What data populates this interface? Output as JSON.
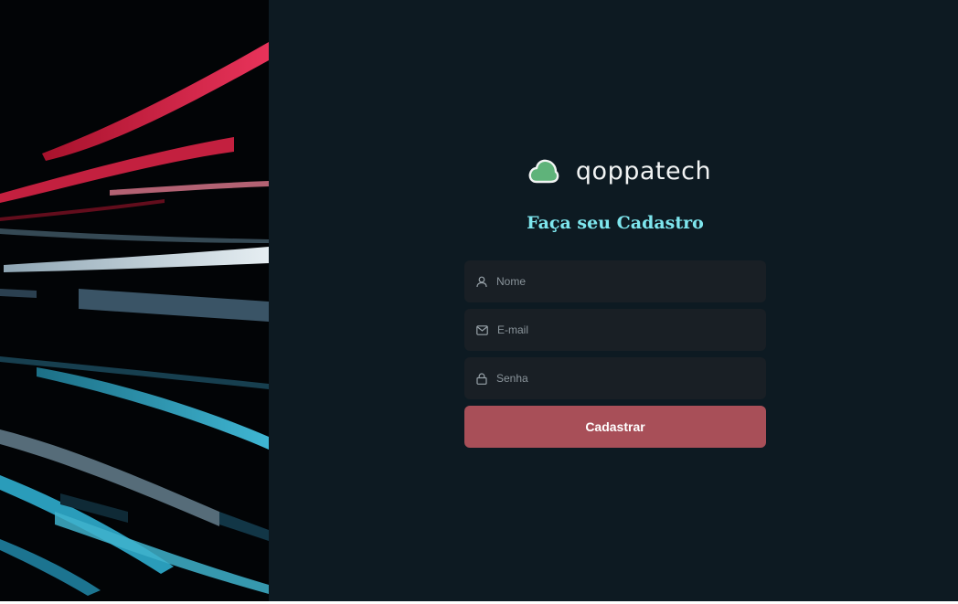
{
  "brand": {
    "name": "qoppatech",
    "logo_icon": "cloud-icon",
    "logo_color": "#5fb37a"
  },
  "form": {
    "title": "Faça seu Cadastro",
    "fields": [
      {
        "name": "name",
        "placeholder": "Nome",
        "value": "",
        "icon": "user-icon"
      },
      {
        "name": "email",
        "placeholder": "E-mail",
        "value": "",
        "icon": "mail-icon"
      },
      {
        "name": "password",
        "placeholder": "Senha",
        "value": "",
        "icon": "lock-icon"
      }
    ],
    "submit_label": "Cadastrar"
  },
  "colors": {
    "background": "#0d1a22",
    "field_background": "#191f25",
    "title": "#7ee6ee",
    "button": "#a84f58"
  }
}
